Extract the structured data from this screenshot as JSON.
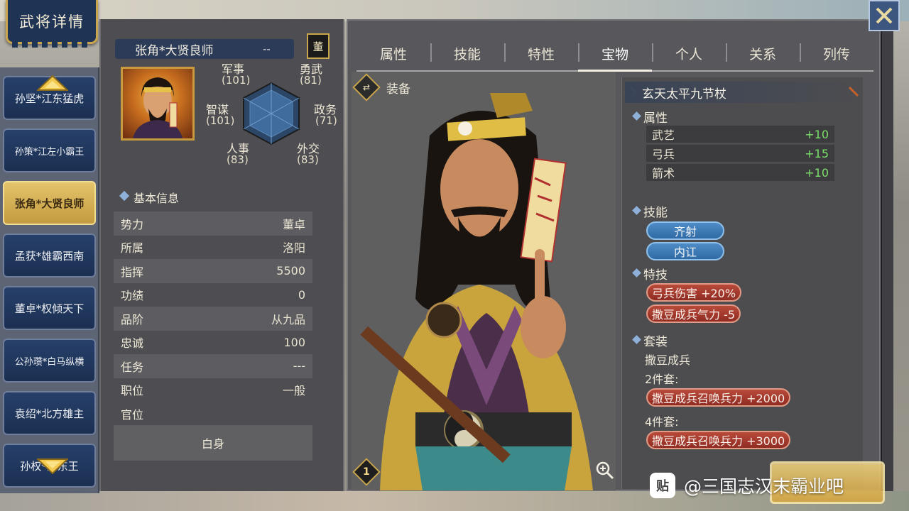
{
  "title": "武将详情",
  "roster": [
    {
      "label": "孙坚*江东猛虎",
      "active": false
    },
    {
      "label": "孙策*江左小霸王",
      "active": false
    },
    {
      "label": "张角*大贤良师",
      "active": true
    },
    {
      "label": "孟获*雄霸西南",
      "active": false
    },
    {
      "label": "董卓*权倾天下",
      "active": false
    },
    {
      "label": "公孙瓒*白马纵横",
      "active": false
    },
    {
      "label": "袁绍*北方雄主",
      "active": false
    },
    {
      "label": "孙权*江东王",
      "active": false
    }
  ],
  "general": {
    "name": "张角*大贤良师",
    "dashes": "--",
    "faction_badge": "董"
  },
  "stats": {
    "military": {
      "label": "军事",
      "value": "(101)"
    },
    "valor": {
      "label": "勇武",
      "value": "(81)"
    },
    "intellect": {
      "label": "智谋",
      "value": "(101)"
    },
    "politics": {
      "label": "政务",
      "value": "(71)"
    },
    "personnel": {
      "label": "人事",
      "value": "(83)"
    },
    "diplomacy": {
      "label": "外交",
      "value": "(83)"
    }
  },
  "basic_info": {
    "title": "基本信息",
    "rows": [
      {
        "label": "势力",
        "value": "董卓"
      },
      {
        "label": "所属",
        "value": "洛阳"
      },
      {
        "label": "指挥",
        "value": "5500"
      },
      {
        "label": "功绩",
        "value": "0"
      },
      {
        "label": "品阶",
        "value": "从九品"
      },
      {
        "label": "忠诚",
        "value": "100"
      },
      {
        "label": "任务",
        "value": "---"
      },
      {
        "label": "职位",
        "value": "一般"
      },
      {
        "label": "官位",
        "value": ""
      }
    ],
    "rank_box": "白身"
  },
  "tabs": [
    "属性",
    "技能",
    "特性",
    "宝物",
    "个人",
    "关系",
    "列传"
  ],
  "active_tab": "宝物",
  "equipment": {
    "title": "装备",
    "level": "1"
  },
  "treasure": {
    "name": "玄天太平九节杖",
    "attributes_title": "属性",
    "attributes": [
      {
        "label": "武艺",
        "value": "+10"
      },
      {
        "label": "弓兵",
        "value": "+15"
      },
      {
        "label": "箭术",
        "value": "+10"
      }
    ],
    "skills_title": "技能",
    "skills": [
      "齐射",
      "内讧"
    ],
    "specials_title": "特技",
    "specials": [
      "弓兵伤害 +20%",
      "撒豆成兵气力 -5"
    ],
    "set_title": "套装",
    "set_name": "撒豆成兵",
    "set_2_label": "2件套:",
    "set_2_bonus": "撒豆成兵召唤兵力 +2000",
    "set_4_label": "4件套:",
    "set_4_bonus": "撒豆成兵召唤兵力 +3000"
  },
  "watermark": {
    "logo": "贴",
    "text": "@三国志汉末霸业吧"
  },
  "colors": {
    "roster_blue": "#1b2f51",
    "roster_gold": "#c39a3f",
    "bonus_green": "#7be06a",
    "skill_blue": "#2f6aa4",
    "special_red": "#8f2c22"
  },
  "icons": [
    "close-icon",
    "arrow-up-icon",
    "arrow-down-icon",
    "swap-icon",
    "zoom-icon",
    "radar-hexagon-icon"
  ]
}
